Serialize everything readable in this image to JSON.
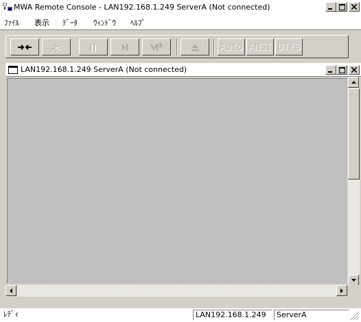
{
  "window": {
    "title": "MWA Remote Console - LAN192.168.1.249   ServerA   (Not connected)",
    "buttons": {
      "minimize_icon": "minimize-icon",
      "maximize_icon": "maximize-icon",
      "close_icon": "close-icon"
    }
  },
  "menu": {
    "items": [
      {
        "label": "ﾌｧｲﾙ"
      },
      {
        "label": "表示"
      },
      {
        "label": "ﾃﾞｰﾀ"
      },
      {
        "label": "ｳｨﾝﾄﾞｳ"
      },
      {
        "label": "ﾍﾙﾌﾟ"
      }
    ]
  },
  "toolbar": {
    "buttons": [
      {
        "icon": "connect-arrows-icon",
        "enabled": true
      },
      {
        "icon": "disconnect-star-icon",
        "enabled": false
      },
      {
        "icon": "pause-icon",
        "enabled": false
      },
      {
        "icon": "step-icon",
        "enabled": false
      },
      {
        "icon": "reset-icon",
        "enabled": false
      },
      {
        "icon": "eject-icon",
        "enabled": false
      }
    ],
    "text_buttons": [
      {
        "label": "Auto"
      },
      {
        "label": "ANSI"
      },
      {
        "label": "UTF8"
      }
    ]
  },
  "child_window": {
    "title": "LAN192.168.1.249   ServerA   (Not connected)"
  },
  "status": {
    "ready": "ﾚﾃﾞｨ",
    "address": "LAN192.168.1.249",
    "server": "ServerA"
  },
  "colors": {
    "face": "#d4d0c8",
    "console_bg": "#c0c0c0",
    "title_bg": "#ffffff"
  }
}
